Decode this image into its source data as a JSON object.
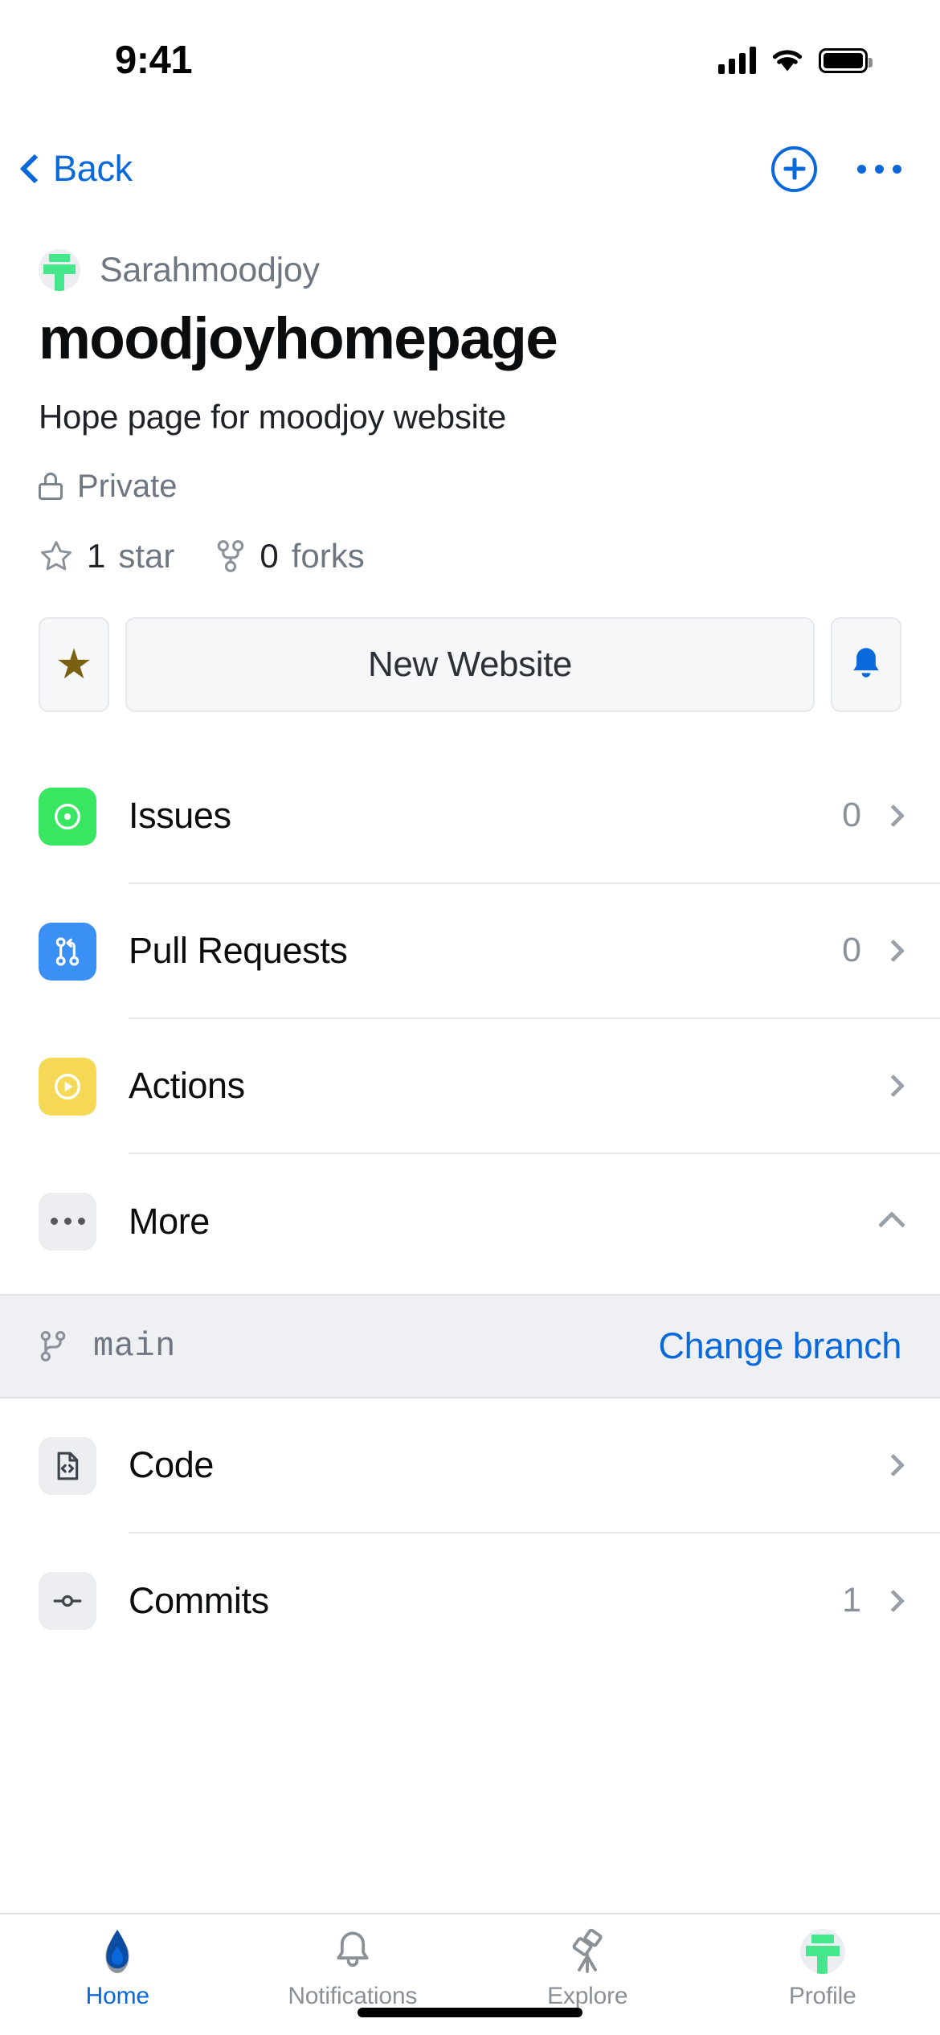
{
  "status_bar": {
    "time": "9:41",
    "signal_icon": "cellular-bars-icon",
    "wifi_icon": "wifi-icon",
    "battery_icon": "battery-full-icon"
  },
  "nav": {
    "back_label": "Back",
    "back_icon": "chevron-left-icon",
    "add_icon": "plus-circle-icon",
    "more_icon": "ellipsis-icon"
  },
  "repo": {
    "owner": "Sarahmoodjoy",
    "owner_avatar_icon": "github-identicon-avatar",
    "name": "moodjoyhomepage",
    "description": "Hope page for moodjoy website",
    "visibility": "Private",
    "visibility_icon": "lock-icon",
    "stars": {
      "count": "1",
      "label": "star",
      "icon": "star-outline-icon"
    },
    "forks": {
      "count": "0",
      "label": "forks",
      "icon": "repo-forked-icon"
    }
  },
  "actions": {
    "star_button_icon": "star-filled-icon",
    "star_color": "#7a6111",
    "primary_label": "New Website",
    "watch_button_icon": "bell-filled-icon",
    "watch_color": "#0969da"
  },
  "menu": [
    {
      "label": "Issues",
      "count": "0",
      "icon": "issue-opened-icon",
      "color": "#38e662",
      "chevron": "chevron-right-icon"
    },
    {
      "label": "Pull Requests",
      "count": "0",
      "icon": "git-pull-request-icon",
      "color": "#3b90f5",
      "chevron": "chevron-right-icon"
    },
    {
      "label": "Actions",
      "count": "",
      "icon": "play-circle-icon",
      "color": "#f5d856",
      "chevron": "chevron-right-icon"
    },
    {
      "label": "More",
      "count": "",
      "icon": "ellipsis-icon",
      "color": "#eceef2",
      "chevron": "chevron-up-icon"
    }
  ],
  "branch": {
    "icon": "git-branch-icon",
    "name": "main",
    "change_label": "Change branch",
    "change_color": "#0969da"
  },
  "code_menu": [
    {
      "label": "Code",
      "count": "",
      "icon": "file-code-icon",
      "chevron": "chevron-right-icon"
    },
    {
      "label": "Commits",
      "count": "1",
      "icon": "git-commit-icon",
      "chevron": "chevron-right-icon"
    }
  ],
  "tabbar": [
    {
      "label": "Home",
      "icon": "home-icon",
      "active": true
    },
    {
      "label": "Notifications",
      "icon": "bell-outline-icon",
      "active": false
    },
    {
      "label": "Explore",
      "icon": "telescope-icon",
      "active": false
    },
    {
      "label": "Profile",
      "icon": "avatar-icon",
      "active": false
    }
  ],
  "accent": "#0969da"
}
